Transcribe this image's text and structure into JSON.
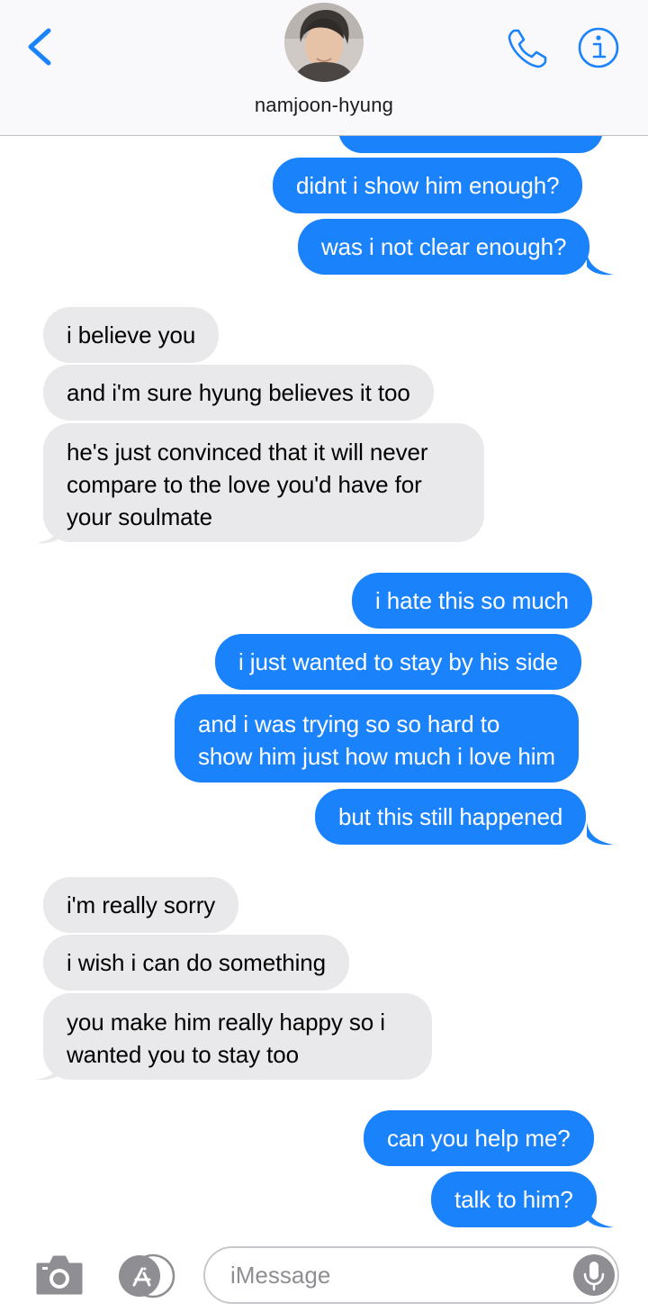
{
  "header": {
    "contact_name": "namjoon-hyung",
    "back_icon": "chevron-left-icon",
    "call_icon": "phone-icon",
    "info_icon": "info-icon",
    "accent_color": "#1a82fb"
  },
  "messages": [
    {
      "side": "sent",
      "text": ""
    },
    {
      "side": "sent",
      "text": "didnt i show him enough?"
    },
    {
      "side": "sent",
      "text": "was i not clear enough?"
    },
    {
      "side": "received",
      "text": "i believe you"
    },
    {
      "side": "received",
      "text": "and i'm sure hyung believes it too"
    },
    {
      "side": "received",
      "lines": [
        "he's just convinced that it will never",
        "compare to the love you'd have for",
        "your soulmate"
      ]
    },
    {
      "side": "sent",
      "text": "i hate this so much"
    },
    {
      "side": "sent",
      "text": "i just wanted to stay by his side"
    },
    {
      "side": "sent",
      "lines": [
        "and i was trying so so hard to",
        "show him just how much i love him"
      ]
    },
    {
      "side": "sent",
      "text": "but this still happened"
    },
    {
      "side": "received",
      "text": "i'm really sorry"
    },
    {
      "side": "received",
      "text": "i wish i can do something"
    },
    {
      "side": "received",
      "lines": [
        "you make him really happy so i",
        "wanted you to stay too"
      ]
    },
    {
      "side": "sent",
      "text": "can you help me?"
    },
    {
      "side": "sent",
      "text": "talk to him?"
    }
  ],
  "colors": {
    "sent_bubble": "#1a82fb",
    "received_bubble": "#e9e9eb"
  },
  "input_bar": {
    "camera_icon": "camera-icon",
    "apps_icon": "app-store-icon",
    "mic_icon": "microphone-icon",
    "placeholder": "iMessage"
  }
}
